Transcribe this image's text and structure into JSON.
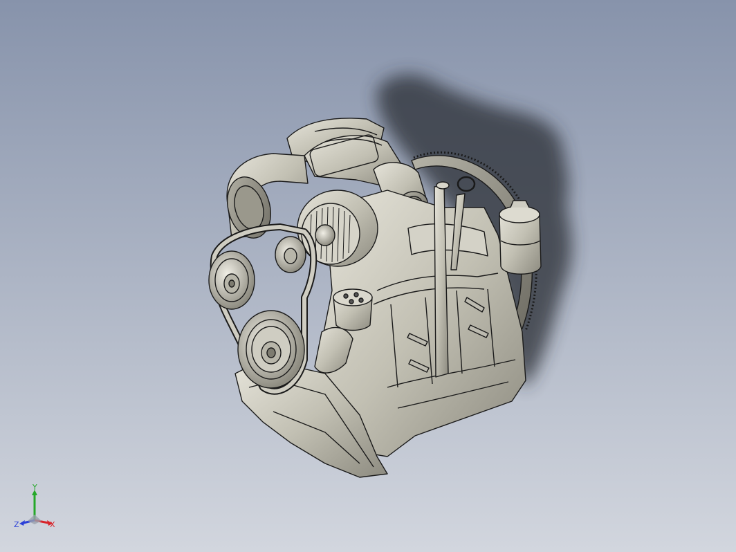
{
  "viewport": {
    "background_top": "#8793ab",
    "background_bottom": "#d2d6de",
    "model_color": "#c9c7bc",
    "edge_color": "#1a1a1a",
    "shadow_color": "#2b2f36"
  },
  "triad": {
    "x_label": "X",
    "y_label": "Y",
    "z_label": "Z",
    "x_color": "#d8232a",
    "y_color": "#25a829",
    "z_color": "#2a3fd8"
  }
}
